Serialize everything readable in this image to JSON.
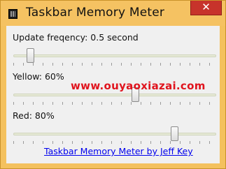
{
  "window": {
    "title": "Taskbar Memory Meter",
    "close_symbol": "✕"
  },
  "controls": {
    "update": {
      "label": "Update freqency: 0.5 second",
      "value": 0.06
    },
    "yellow": {
      "label": "Yellow: 60%",
      "value": 0.6
    },
    "red": {
      "label": "Red: 80%",
      "value": 0.8
    }
  },
  "footer": {
    "link": "Taskbar Memory Meter by Jeff Key"
  },
  "watermark": "www.ouyaoxiazai.com"
}
